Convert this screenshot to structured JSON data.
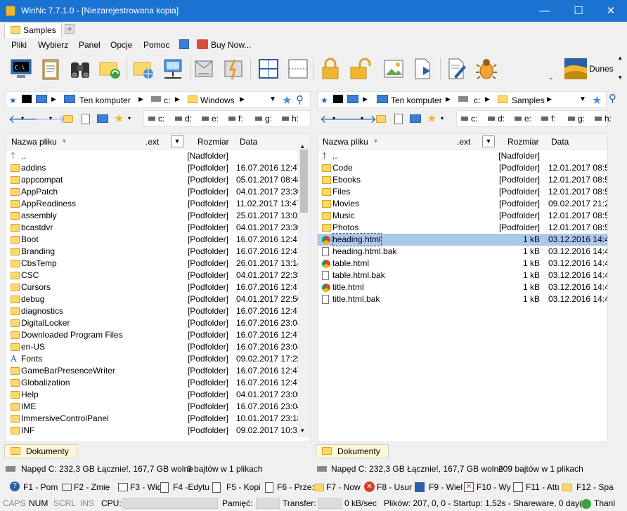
{
  "window": {
    "title": "WinNc 7.7.1.0 - [Niezarejestrowana kopia]",
    "minimize": "—",
    "maximize": "☐",
    "close": "✕"
  },
  "tabs": [
    {
      "label": "Samples"
    }
  ],
  "tab_add": "+",
  "menu": [
    "Pliki",
    "Wybierz",
    "Panel",
    "Opcje",
    "Pomoc",
    "Buy Now..."
  ],
  "toolbar": {
    "dunes_label": "Dunes"
  },
  "left": {
    "path": {
      "computer": "Ten komputer",
      "drive": "c:",
      "folder": "Windows"
    },
    "drives": [
      "c:",
      "d:",
      "e:",
      "f:",
      "g:",
      "h:"
    ],
    "columns": {
      "name": "Nazwa pliku",
      "ext": ".ext",
      "size": "Rozmiar",
      "date": "Data"
    },
    "rows": [
      {
        "name": "..",
        "type": "[Nadfolder]",
        "date": ""
      },
      {
        "name": "addins",
        "type": "[Podfolder]",
        "date": "16.07.2016 12:47"
      },
      {
        "name": "appcompat",
        "type": "[Podfolder]",
        "date": "05.01.2017 08:48"
      },
      {
        "name": "AppPatch",
        "type": "[Podfolder]",
        "date": "04.01.2017 23:30"
      },
      {
        "name": "AppReadiness",
        "type": "[Podfolder]",
        "date": "11.02.2017 13:47"
      },
      {
        "name": "assembly",
        "type": "[Podfolder]",
        "date": "25.01.2017 13:02"
      },
      {
        "name": "bcastdvr",
        "type": "[Podfolder]",
        "date": "04.01.2017 23:30"
      },
      {
        "name": "Boot",
        "type": "[Podfolder]",
        "date": "16.07.2016 12:47"
      },
      {
        "name": "Branding",
        "type": "[Podfolder]",
        "date": "16.07.2016 12:47"
      },
      {
        "name": "CbsTemp",
        "type": "[Podfolder]",
        "date": "26.01.2017 13:14"
      },
      {
        "name": "CSC",
        "type": "[Podfolder]",
        "date": "04.01.2017 22:35"
      },
      {
        "name": "Cursors",
        "type": "[Podfolder]",
        "date": "16.07.2016 12:47"
      },
      {
        "name": "debug",
        "type": "[Podfolder]",
        "date": "04.01.2017 22:50"
      },
      {
        "name": "diagnostics",
        "type": "[Podfolder]",
        "date": "16.07.2016 12:47"
      },
      {
        "name": "DigitalLocker",
        "type": "[Podfolder]",
        "date": "16.07.2016 23:04"
      },
      {
        "name": "Downloaded Program Files",
        "type": "[Podfolder]",
        "date": "16.07.2016 12:47"
      },
      {
        "name": "en-US",
        "type": "[Podfolder]",
        "date": "16.07.2016 23:04"
      },
      {
        "name": "Fonts",
        "type": "[Podfolder]",
        "date": "09.02.2017 17:25"
      },
      {
        "name": "GameBarPresenceWriter",
        "type": "[Podfolder]",
        "date": "16.07.2016 12:47"
      },
      {
        "name": "Globalization",
        "type": "[Podfolder]",
        "date": "16.07.2016 12:47"
      },
      {
        "name": "Help",
        "type": "[Podfolder]",
        "date": "04.01.2017 23:05"
      },
      {
        "name": "IME",
        "type": "[Podfolder]",
        "date": "16.07.2016 23:04"
      },
      {
        "name": "ImmersiveControlPanel",
        "type": "[Podfolder]",
        "date": "10.01.2017 23:18"
      },
      {
        "name": "INF",
        "type": "[Podfolder]",
        "date": "09.02.2017 10:31"
      }
    ],
    "bookmark": "Dokumenty",
    "drive_info": "Napęd C: 232,3 GB Łącznie!, 167,7 GB wolne",
    "sel_info": "0 bajtów w 1 plikach"
  },
  "right": {
    "path": {
      "drive": "c:",
      "folder": "Samples",
      "computer": "Ten komputer"
    },
    "drives": [
      "c:",
      "d:",
      "e:",
      "f:",
      "g:",
      "h:"
    ],
    "columns": {
      "name": "Nazwa pliku",
      "ext": ".ext",
      "size": "Rozmiar",
      "date": "Data"
    },
    "rows": [
      {
        "name": "..",
        "type": "[Nadfolder]",
        "date": "",
        "kind": "up"
      },
      {
        "name": "Code",
        "type": "[Podfolder]",
        "date": "12.01.2017 08:54",
        "kind": "folder"
      },
      {
        "name": "Ebooks",
        "type": "[Podfolder]",
        "date": "12.01.2017 08:56",
        "kind": "folder"
      },
      {
        "name": "Files",
        "type": "[Podfolder]",
        "date": "12.01.2017 08:54",
        "kind": "folder"
      },
      {
        "name": "Movies",
        "type": "[Podfolder]",
        "date": "09.02.2017 21:27",
        "kind": "folder"
      },
      {
        "name": "Music",
        "type": "[Podfolder]",
        "date": "12.01.2017 08:54",
        "kind": "folder"
      },
      {
        "name": "Photos",
        "type": "[Podfolder]",
        "date": "12.01.2017 08:54",
        "kind": "folder"
      },
      {
        "name": "heading.html",
        "type": "1 kB",
        "date": "03.12.2016 14:42",
        "kind": "chrome"
      },
      {
        "name": "heading.html.bak",
        "type": "1 kB",
        "date": "03.12.2016 14:41",
        "kind": "file"
      },
      {
        "name": "table.html",
        "type": "1 kB",
        "date": "03.12.2016 14:42",
        "kind": "chrome"
      },
      {
        "name": "table.html.bak",
        "type": "1 kB",
        "date": "03.12.2016 14:41",
        "kind": "file"
      },
      {
        "name": "title.html",
        "type": "1 kB",
        "date": "03.12.2016 14:42",
        "kind": "chrome"
      },
      {
        "name": "title.html.bak",
        "type": "1 kB",
        "date": "03.12.2016 14:40",
        "kind": "file"
      }
    ],
    "bookmark": "Dokumenty",
    "drive_info": "Napęd C: 232,3 GB Łącznie!, 167,7 GB wolne",
    "sel_info": "209 bajtów w 1 plikach"
  },
  "fkeys": [
    "F1 - Pom",
    "F2 - Zmie",
    "F3 - Wido",
    "F4 -Edytu",
    "F5 - Kopi",
    "F6 - Prze:",
    "F7 - Now",
    "F8 - Usur",
    "F9 - Wiel",
    "F10 - Wy",
    "F11 - Attı",
    "F12 - Spa"
  ],
  "status": {
    "caps": "CAPS",
    "num": "NUM",
    "scrl": "SCRL",
    "ins": "INS",
    "cpu": "CPU:",
    "mem": "Pamięć:",
    "transfer": "Transfer:",
    "speed": "0 kB/sec",
    "info": "Plików: 207, 0, 0 - Startup: 1,52s - Shareware, 0 day(s)",
    "user": "Thanl"
  },
  "colors": {
    "titlebar": "#1a73d1",
    "selection": "#aac8ea",
    "folder": "#ffd86a"
  }
}
